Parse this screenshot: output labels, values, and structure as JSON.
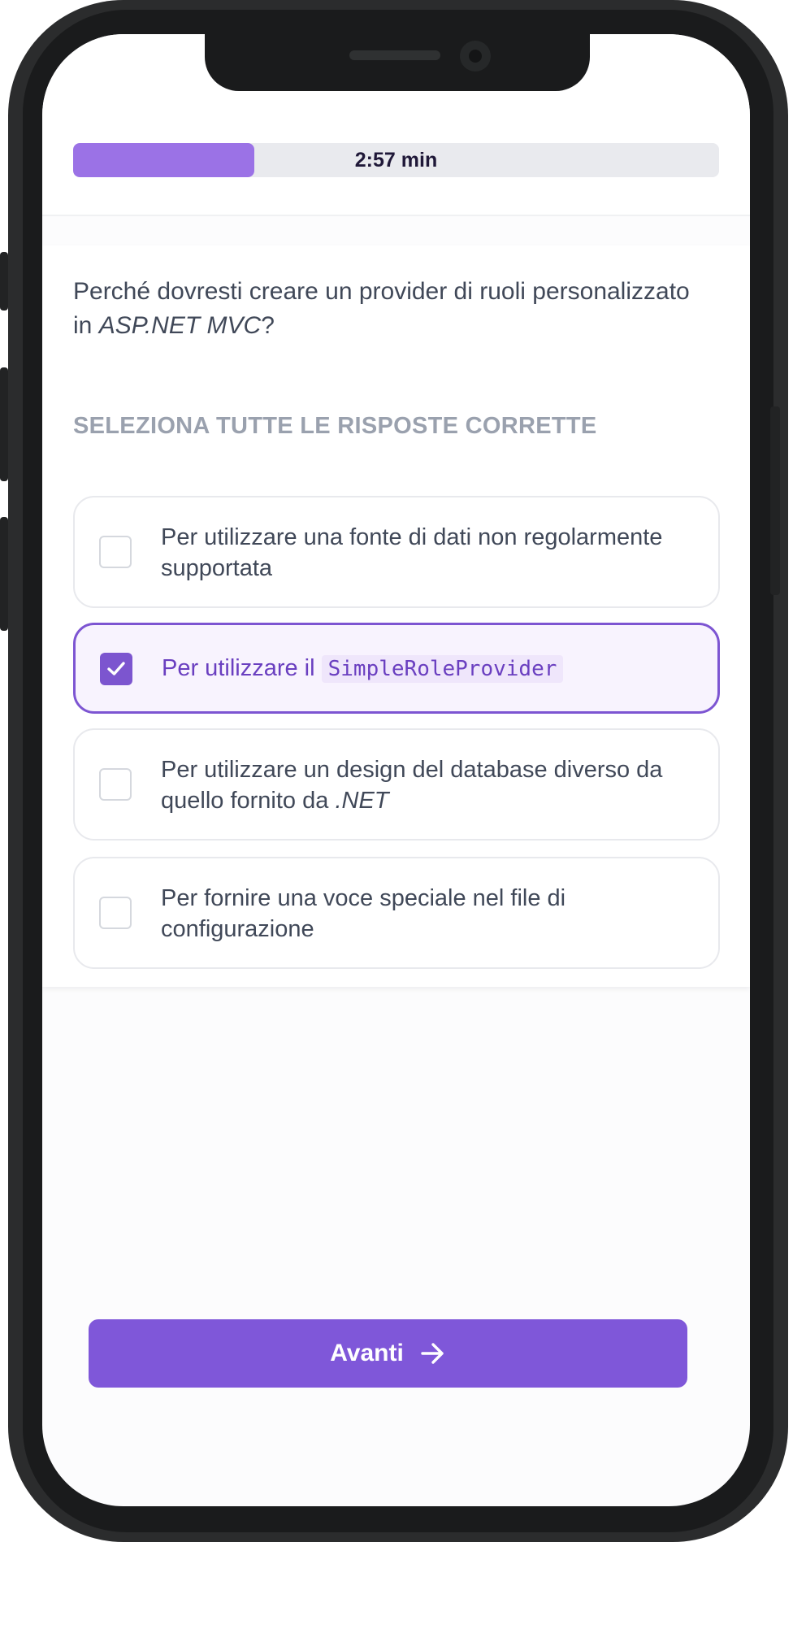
{
  "timer": {
    "label": "2:57 min",
    "progress": 0.28
  },
  "question": {
    "text_prefix": "Perché dovresti creare un provider di ruoli personalizzato in ",
    "text_emphasis": "ASP.NET MVC",
    "text_suffix": "?"
  },
  "instruction": "SELEZIONA TUTTE LE RISPOSTE CORRETTE",
  "options": [
    {
      "text": "Per utilizzare una fonte di dati non regolarmente supportata",
      "selected": false
    },
    {
      "text": "Per utilizzare il ",
      "code": "SimpleRoleProvider",
      "selected": true
    },
    {
      "text": "Per utilizzare un design del database diverso da quello fornito da ",
      "emphasis": ".NET",
      "selected": false
    },
    {
      "text": "Per fornire una voce speciale nel file di configurazione",
      "selected": false
    }
  ],
  "next_button": {
    "label": "Avanti",
    "icon": "arrow-right-icon"
  },
  "colors": {
    "accent": "#7f57d9",
    "progress_fill": "#9b72e6",
    "selected_bg": "#f8f3fe"
  }
}
